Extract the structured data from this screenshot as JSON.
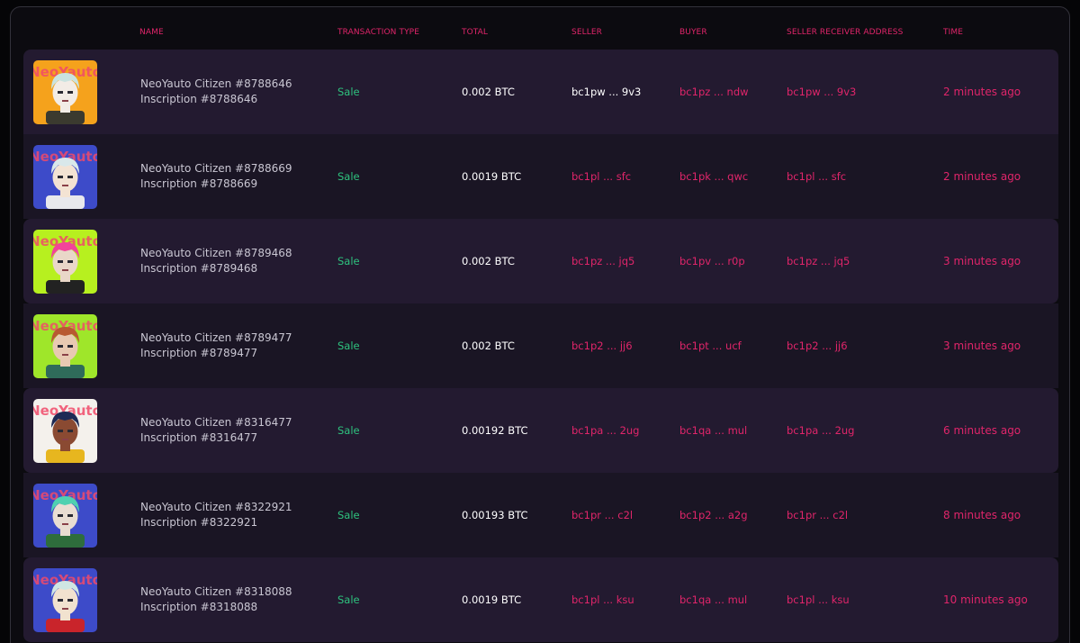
{
  "table": {
    "columns": {
      "name": "NAME",
      "transaction_type": "TRANSACTION TYPE",
      "total": "TOTAL",
      "seller": "SELLER",
      "buyer": "BUYER",
      "seller_receiver_address": "SELLER RECEIVER ADDRESS",
      "time": "TIME"
    },
    "rows": [
      {
        "name": "NeoYauto Citizen #8788646",
        "inscription": "Inscription #8788646",
        "type": "Sale",
        "total": "0.002 BTC",
        "seller": "bc1pw ... 9v3",
        "seller_color": "#ffffff",
        "buyer": "bc1pz ... ndw",
        "receiver": "bc1pw ... 9v3",
        "time": "2 minutes ago",
        "bg": "#f5a21c",
        "hair": "#c9e3e0",
        "skin": "#f2ece6",
        "shirt": "#3b3a2f"
      },
      {
        "name": "NeoYauto Citizen #8788669",
        "inscription": "Inscription #8788669",
        "type": "Sale",
        "total": "0.0019 BTC",
        "seller": "bc1pl ... sfc",
        "seller_color": "#e0256a",
        "buyer": "bc1pk ... qwc",
        "receiver": "bc1pl ... sfc",
        "time": "2 minutes ago",
        "bg": "#3d4bc9",
        "hair": "#d9e8ea",
        "skin": "#f3e3d3",
        "shirt": "#e8e8ec"
      },
      {
        "name": "NeoYauto Citizen #8789468",
        "inscription": "Inscription #8789468",
        "type": "Sale",
        "total": "0.002 BTC",
        "seller": "bc1pz ... jq5",
        "seller_color": "#e0256a",
        "buyer": "bc1pv ... r0p",
        "receiver": "bc1pz ... jq5",
        "time": "3 minutes ago",
        "bg": "#b7f01f",
        "hair": "#f2449a",
        "skin": "#e9d7c8",
        "shirt": "#222222"
      },
      {
        "name": "NeoYauto Citizen #8789477",
        "inscription": "Inscription #8789477",
        "type": "Sale",
        "total": "0.002 BTC",
        "seller": "bc1p2 ... jj6",
        "seller_color": "#e0256a",
        "buyer": "bc1pt ... ucf",
        "receiver": "bc1p2 ... jj6",
        "time": "3 minutes ago",
        "bg": "#9fe62a",
        "hair": "#b85a32",
        "skin": "#e8c9b2",
        "shirt": "#2f6b5a"
      },
      {
        "name": "NeoYauto Citizen #8316477",
        "inscription": "Inscription #8316477",
        "type": "Sale",
        "total": "0.00192 BTC",
        "seller": "bc1pa ... 2ug",
        "seller_color": "#e0256a",
        "buyer": "bc1qa ... mul",
        "receiver": "bc1pa ... 2ug",
        "time": "6 minutes ago",
        "bg": "#f4f1ec",
        "hair": "#1e2a55",
        "skin": "#8a4a32",
        "shirt": "#e7b61f"
      },
      {
        "name": "NeoYauto Citizen #8322921",
        "inscription": "Inscription #8322921",
        "type": "Sale",
        "total": "0.00193 BTC",
        "seller": "bc1pr ... c2l",
        "seller_color": "#e0256a",
        "buyer": "bc1p2 ... a2g",
        "receiver": "bc1pr ... c2l",
        "time": "8 minutes ago",
        "bg": "#3d4bc9",
        "hair": "#4fd1b0",
        "skin": "#e9ddd2",
        "shirt": "#2e6d3c"
      },
      {
        "name": "NeoYauto Citizen #8318088",
        "inscription": "Inscription #8318088",
        "type": "Sale",
        "total": "0.0019 BTC",
        "seller": "bc1pl ... ksu",
        "seller_color": "#e0256a",
        "buyer": "bc1qa ... mul",
        "receiver": "bc1pl ... ksu",
        "time": "10 minutes ago",
        "bg": "#3d4bc9",
        "hair": "#cfe6e3",
        "skin": "#f1e2cf",
        "shirt": "#c9242b"
      }
    ]
  }
}
